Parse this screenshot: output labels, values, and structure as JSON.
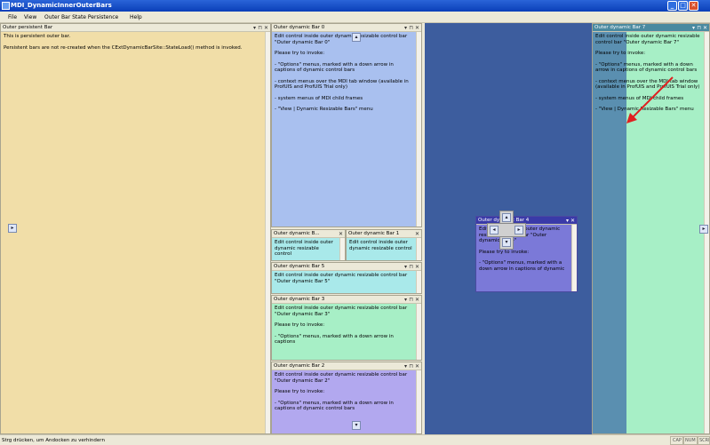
{
  "window": {
    "title": "MDI_DynamicInnerOuterBars",
    "min": "_",
    "max": "□",
    "close": "✕"
  },
  "menu": {
    "file": "File",
    "view": "View",
    "persistence": "Outer Bar State Persistence",
    "help": "Help"
  },
  "persistent": {
    "caption": "Outer persistent Bar",
    "text": [
      "This is persistent outer bar.",
      "Persistent bars are not re-created when the CExtDynamicBarSite::StateLoad() method is invoked."
    ]
  },
  "bar0": {
    "caption": "Outer dynamic Bar 0",
    "lines": [
      "Edit control inside outer dynamic resizable control bar \"Outer dynamic Bar 0\"",
      "Please try to invoke:",
      "- \"Options\" menus, marked with a down arrow in captions of dynamic control bars",
      "- context menus over the MDI tab window (available in ProfUIS and ProfUIS Trial only)",
      "- system menus of MDI child frames",
      "- \"View | Dynamic Resizable Bars\" menu"
    ]
  },
  "bar6": {
    "caption": "Outer dynamic B...",
    "lines": [
      "Edit control inside outer dynamic resizable control"
    ]
  },
  "bar1": {
    "caption": "Outer dynamic Bar 1",
    "lines": [
      "Edit control inside outer dynamic resizable control"
    ]
  },
  "bar5": {
    "caption": "Outer dynamic Bar 5",
    "lines": [
      "Edit control inside outer dynamic resizable control bar \"Outer dynamic Bar 5\""
    ]
  },
  "bar3": {
    "caption": "Outer dynamic Bar 3",
    "lines": [
      "Edit control inside outer dynamic resizable control bar \"Outer dynamic Bar 3\"",
      "Please try to invoke:",
      "- \"Options\" menus, marked with a down arrow in captions"
    ]
  },
  "bar2": {
    "caption": "Outer dynamic Bar 2",
    "lines": [
      "Edit control inside outer dynamic resizable control bar \"Outer dynamic Bar 2\"",
      "Please try to invoke:",
      "- \"Options\" menus, marked with a down arrow in captions of dynamic control bars"
    ]
  },
  "floatbar": {
    "caption": "Outer dynamic Bar 4",
    "lines": [
      "Edit control inside outer dynamic resizable control bar \"Outer dynamic Bar 4\"",
      "Please try to invoke:",
      "- \"Options\" menus, marked with a down arrow in captions of dynamic"
    ]
  },
  "bar7": {
    "caption": "Outer dynamic Bar 7",
    "lines": [
      "Edit control inside outer dynamic resizable control bar \"Outer dynamic Bar 7\"",
      "Please try to invoke:",
      "- \"Options\" menus, marked with a down arrow in captions of dynamic control bars",
      "- context menus over the MDI tab window (available in ProfUIS and ProfUIS Trial only)",
      "- system menus of MDI child frames",
      "- \"View | Dynamic Resizable Bars\" menu"
    ]
  },
  "status": {
    "text": "Strg drücken, um Andocken zu verhindern",
    "cap": "CAP",
    "num": "NUM",
    "scrl": "SCRL"
  },
  "colors": {
    "persistent": "#f1dea8",
    "bar0": "#a9c0ef",
    "cyan": "#a9e9ea",
    "green": "#a7efc6",
    "lilac": "#b2a8ef",
    "mdi": "#3d5d9e",
    "float": "#7b79d8",
    "preview": "#5a8fb0"
  }
}
